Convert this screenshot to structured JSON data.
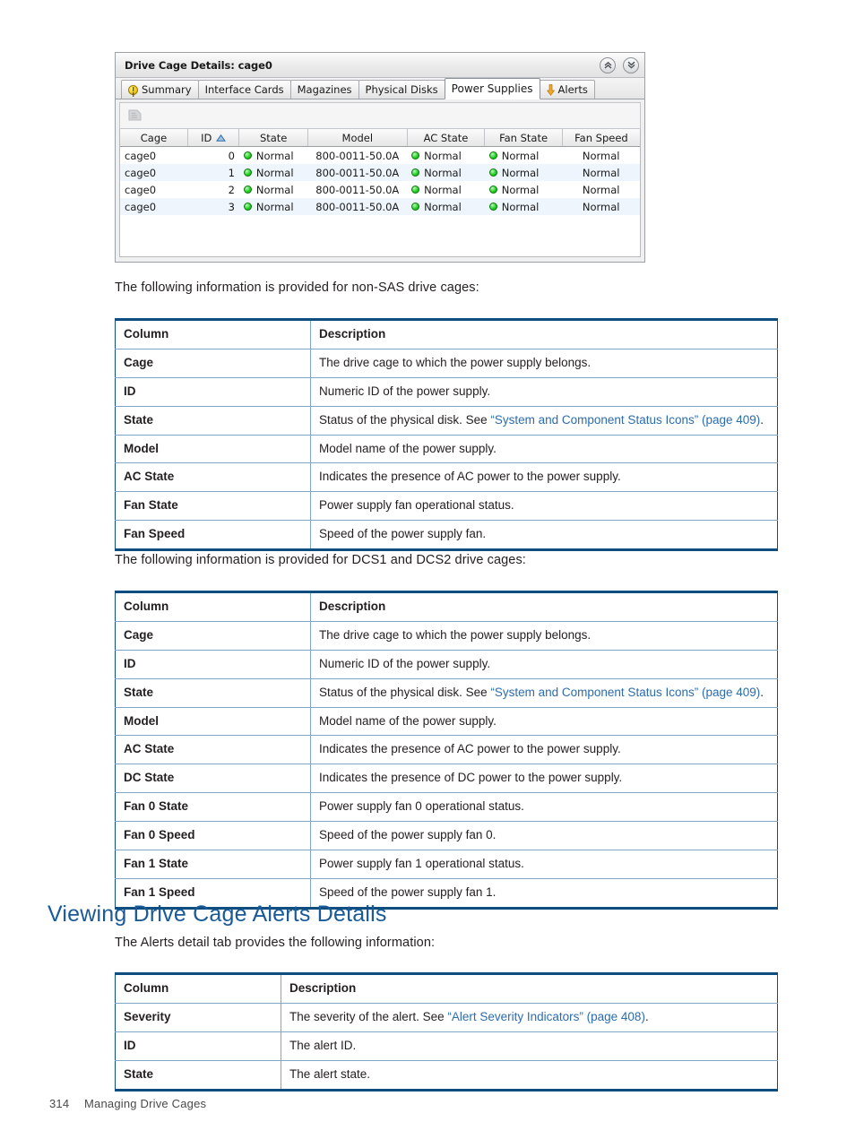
{
  "colors": {
    "heading_blue": "#1a5a99",
    "table_border_dark": "#0e4d80",
    "table_border_light": "#7fa6c7",
    "link_blue": "#2b6cb0",
    "status_green": "#22cc22",
    "alert_orange": "#f5a623"
  },
  "gui": {
    "title": "Drive Cage Details: cage0",
    "titlebar_buttons": [
      {
        "name": "collapse-all-button",
        "icon": "double-chevron-up-icon"
      },
      {
        "name": "expand-all-button",
        "icon": "double-chevron-down-icon"
      }
    ],
    "tabs": [
      {
        "label": "Summary",
        "icon": "warning-icon",
        "active": false
      },
      {
        "label": "Interface Cards",
        "icon": "",
        "active": false
      },
      {
        "label": "Magazines",
        "icon": "",
        "active": false
      },
      {
        "label": "Physical Disks",
        "icon": "",
        "active": false
      },
      {
        "label": "Power Supplies",
        "icon": "",
        "active": true
      },
      {
        "label": "Alerts",
        "icon": "down-arrow-icon",
        "active": false
      }
    ],
    "toolbar": {
      "export_icon": "export-icon",
      "export_enabled": false
    },
    "grid": {
      "columns": [
        "Cage",
        "ID",
        "State",
        "Model",
        "AC State",
        "Fan State",
        "Fan Speed"
      ],
      "sorted_column": "ID",
      "sort_direction": "ascending",
      "rows": [
        {
          "cage": "cage0",
          "id": "0",
          "state": "Normal",
          "model": "800-0011-50.0A",
          "ac_state": "Normal",
          "fan_state": "Normal",
          "fan_speed": "Normal"
        },
        {
          "cage": "cage0",
          "id": "1",
          "state": "Normal",
          "model": "800-0011-50.0A",
          "ac_state": "Normal",
          "fan_state": "Normal",
          "fan_speed": "Normal"
        },
        {
          "cage": "cage0",
          "id": "2",
          "state": "Normal",
          "model": "800-0011-50.0A",
          "ac_state": "Normal",
          "fan_state": "Normal",
          "fan_speed": "Normal"
        },
        {
          "cage": "cage0",
          "id": "3",
          "state": "Normal",
          "model": "800-0011-50.0A",
          "ac_state": "Normal",
          "fan_state": "Normal",
          "fan_speed": "Normal"
        }
      ]
    }
  },
  "doc": {
    "intro_nonsas": "The following information is provided for non-SAS drive cages:",
    "intro_dcs": "The following information is provided for DCS1 and DCS2 drive cages:",
    "heading_alerts": "Viewing Drive Cage Alerts Details",
    "intro_alerts": "The Alerts detail tab provides the following information:",
    "table_nonsas": {
      "header": {
        "col1": "Column",
        "col2": "Description"
      },
      "rows": [
        {
          "col1": "Cage",
          "col2": "The drive cage to which the power supply belongs."
        },
        {
          "col1": "ID",
          "col2": "Numeric ID of the power supply."
        },
        {
          "col1": "State",
          "col2_pre": "Status of the physical disk. See ",
          "col2_link": "“System and Component Status Icons” (page 409)",
          "col2_post": "."
        },
        {
          "col1": "Model",
          "col2": "Model name of the power supply."
        },
        {
          "col1": "AC State",
          "col2": "Indicates the presence of AC power to the power supply."
        },
        {
          "col1": "Fan State",
          "col2": "Power supply fan operational status."
        },
        {
          "col1": "Fan Speed",
          "col2": "Speed of the power supply fan."
        }
      ]
    },
    "table_dcs": {
      "header": {
        "col1": "Column",
        "col2": "Description"
      },
      "rows": [
        {
          "col1": "Cage",
          "col2": "The drive cage to which the power supply belongs."
        },
        {
          "col1": "ID",
          "col2": "Numeric ID of the power supply."
        },
        {
          "col1": "State",
          "col2_pre": "Status of the physical disk. See ",
          "col2_link": "“System and Component Status Icons” (page 409)",
          "col2_post": "."
        },
        {
          "col1": "Model",
          "col2": "Model name of the power supply."
        },
        {
          "col1": "AC State",
          "col2": "Indicates the presence of AC power to the power supply."
        },
        {
          "col1": "DC State",
          "col2": "Indicates the presence of DC power to the power supply."
        },
        {
          "col1": "Fan 0 State",
          "col2": "Power supply fan 0 operational status."
        },
        {
          "col1": "Fan 0 Speed",
          "col2": "Speed of the power supply fan 0."
        },
        {
          "col1": "Fan 1 State",
          "col2": "Power supply fan 1 operational status."
        },
        {
          "col1": "Fan 1 Speed",
          "col2": "Speed of the power supply fan 1."
        }
      ]
    },
    "table_alerts": {
      "header": {
        "col1": "Column",
        "col2": "Description"
      },
      "rows": [
        {
          "col1": "Severity",
          "col2_pre": "The severity of the alert. See ",
          "col2_link": "“Alert Severity Indicators” (page 408)",
          "col2_post": "."
        },
        {
          "col1": "ID",
          "col2": "The alert ID."
        },
        {
          "col1": "State",
          "col2": "The alert state."
        }
      ]
    }
  },
  "footer": {
    "page_number": "314",
    "chapter": "Managing Drive Cages"
  }
}
